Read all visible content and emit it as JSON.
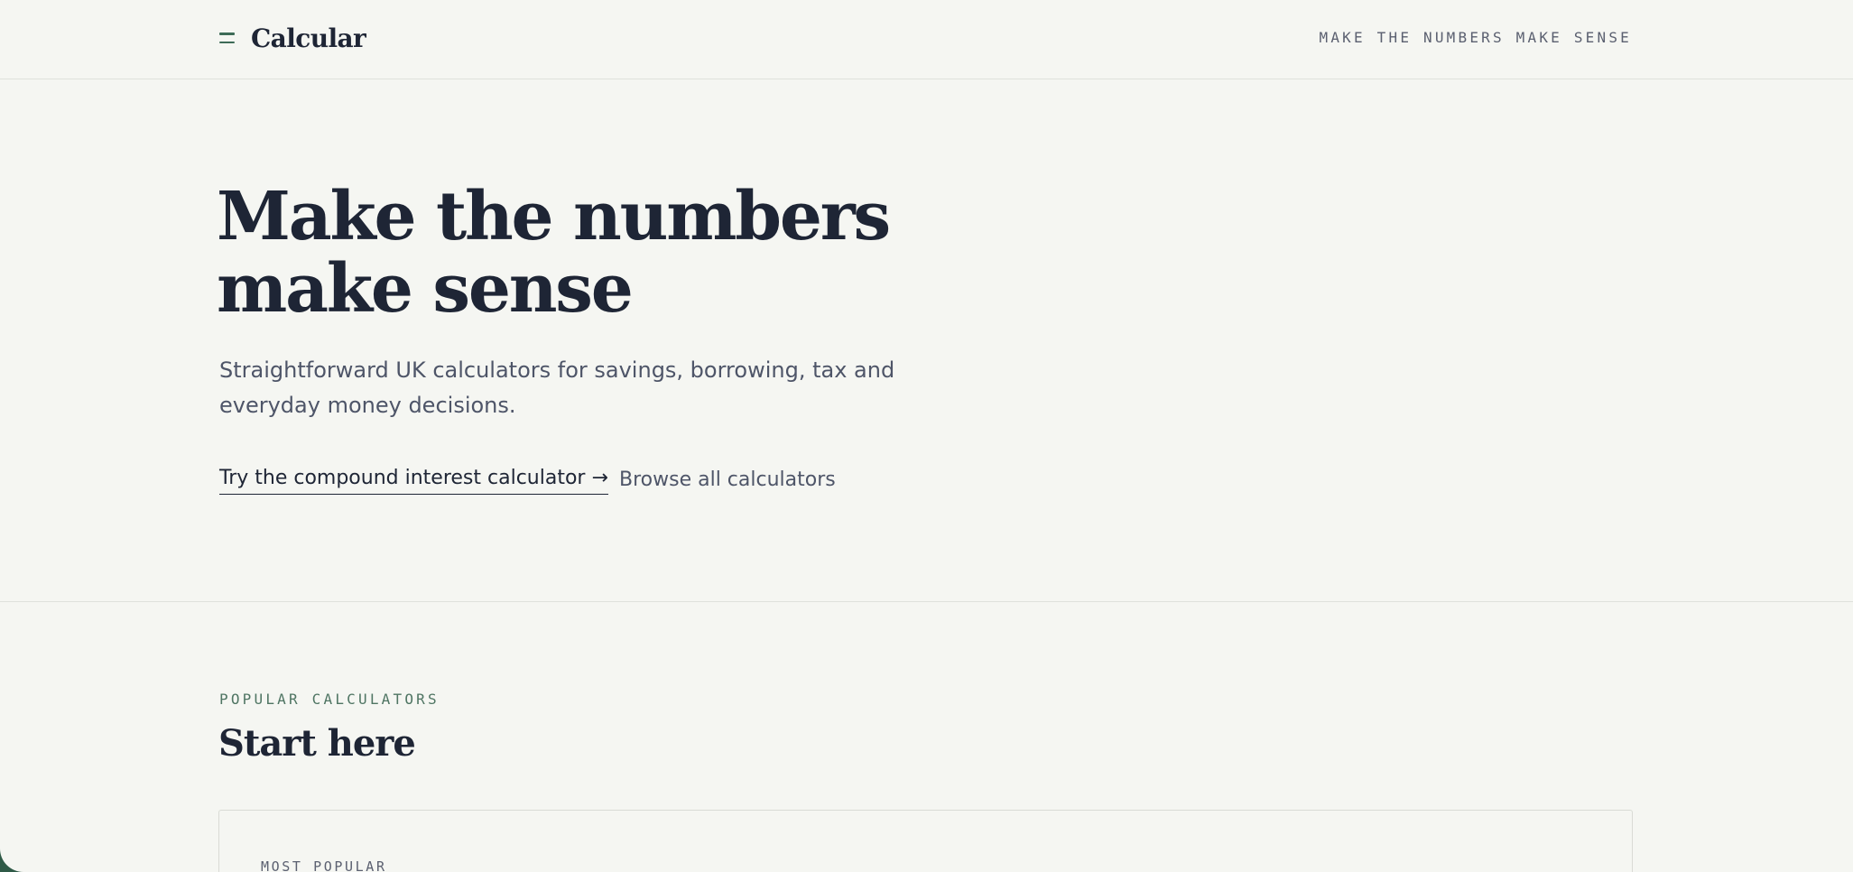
{
  "header": {
    "brand": "Calcular",
    "tagline": "MAKE THE NUMBERS MAKE SENSE"
  },
  "hero": {
    "title": "Make the numbers make sense",
    "subtitle": "Straightforward UK calculators for savings, borrowing, tax and everyday money decisions.",
    "cta_primary": "Try the compound interest calculator →",
    "cta_secondary": "Browse all calculators"
  },
  "popular": {
    "eyebrow": "POPULAR CALCULATORS",
    "title": "Start here",
    "card_eyebrow": "MOST POPULAR"
  },
  "colors": {
    "background": "#f5f6f2",
    "text": "#1e2535",
    "muted": "#4e5568",
    "accent": "#3d6b57"
  }
}
